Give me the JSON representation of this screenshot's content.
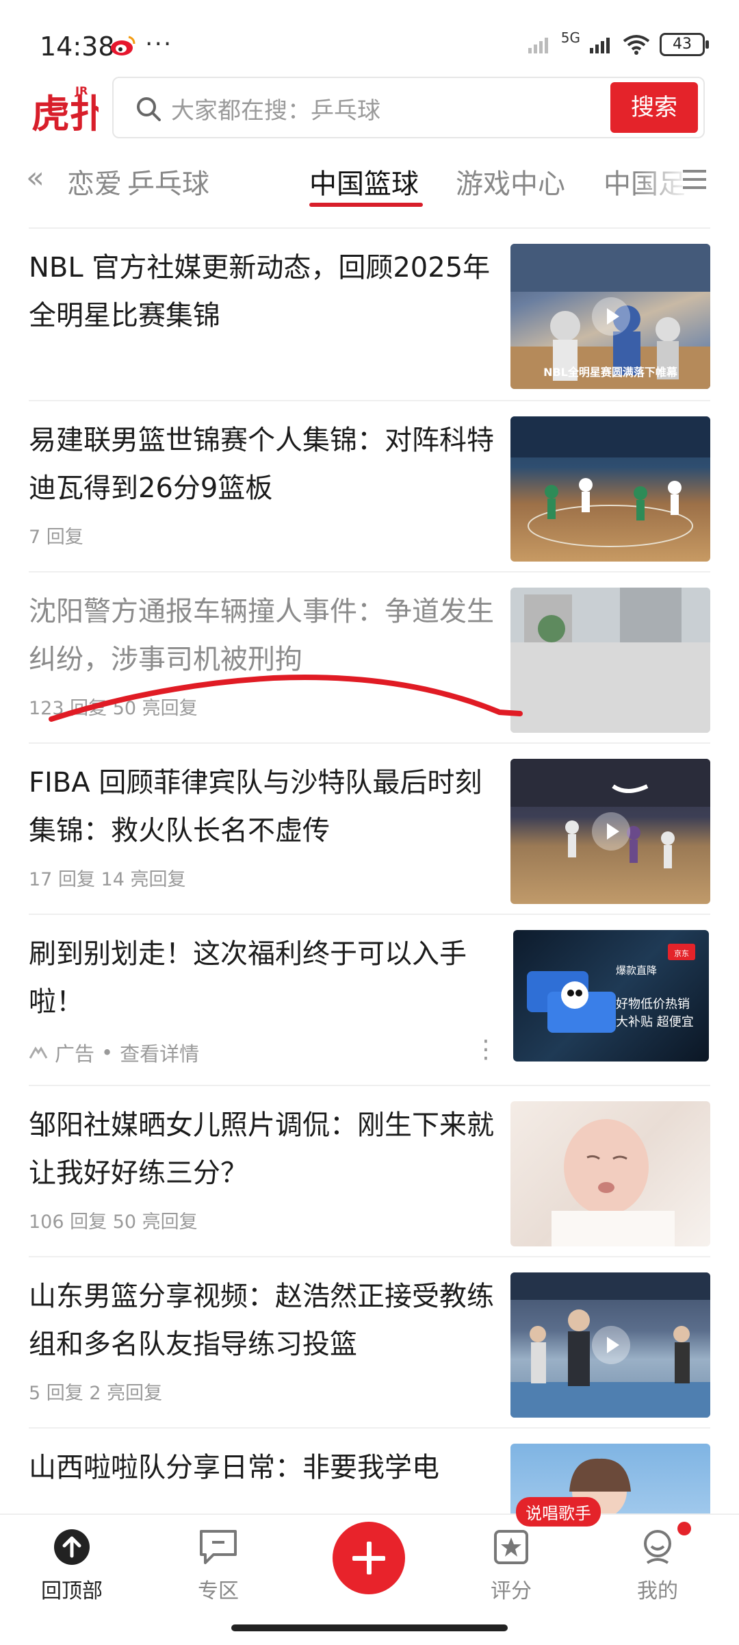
{
  "status_bar": {
    "time": "14:38",
    "network": "5G",
    "battery": "43"
  },
  "header": {
    "logo_text": "虎扑",
    "logo_badge": "JR",
    "search_placeholder": "大家都在搜：乒乓球",
    "search_button": "搜索"
  },
  "tabs": {
    "items": [
      "恋爱",
      "乒乓球",
      "中国篮球",
      "游戏中心",
      "中国足"
    ],
    "active_index": 2
  },
  "feed": [
    {
      "title": "NBL 官方社媒更新动态，回顾2025年全明星比赛集锦",
      "meta": "",
      "thumb_caption": "NBL全明星赛圆满落下帷幕",
      "video": true
    },
    {
      "title": "易建联男篮世锦赛个人集锦：对阵科特迪瓦得到26分9篮板",
      "meta": "7 回复",
      "thumb_caption": "",
      "video": false
    },
    {
      "title": "沈阳警方通报车辆撞人事件：争道发生纠纷，涉事司机被刑拘",
      "meta": "123 回复  50 亮回复",
      "thumb_caption": "",
      "video": false,
      "read": true
    },
    {
      "title": "FIBA 回顾菲律宾队与沙特队最后时刻集锦：救火队长名不虚传",
      "meta": "17 回复  14 亮回复",
      "thumb_caption": "",
      "video": true
    },
    {
      "title": "刷到别划走！这次福利终于可以入手啦！",
      "meta": "",
      "ad": {
        "label": "广告",
        "dot": "•",
        "detail": "查看详情",
        "thumb_tag": "爆款直降",
        "thumb_line1": "好物低价热销",
        "thumb_line2": "大补贴 超便宜",
        "brand": "京东"
      }
    },
    {
      "title": "邹阳社媒晒女儿照片调侃：刚生下来就让我好好练三分？",
      "meta": "106 回复  50 亮回复",
      "thumb_caption": "",
      "video": false
    },
    {
      "title": "山东男篮分享视频：赵浩然正接受教练组和多名队友指导练习投篮",
      "meta": "5 回复  2 亮回复",
      "thumb_caption": "",
      "video": true
    },
    {
      "title": "山西啦啦队分享日常：非要我学电",
      "meta": "",
      "thumb_caption": "",
      "video": false
    }
  ],
  "bottom_nav": {
    "items": [
      {
        "label": "回顶部"
      },
      {
        "label": "专区"
      },
      {
        "label": ""
      },
      {
        "label": "评分"
      },
      {
        "label": "我的"
      }
    ],
    "badge": "说唱歌手"
  },
  "colors": {
    "accent": "#e4232a",
    "text": "#1b1b1b",
    "muted": "#9a9a9a"
  }
}
